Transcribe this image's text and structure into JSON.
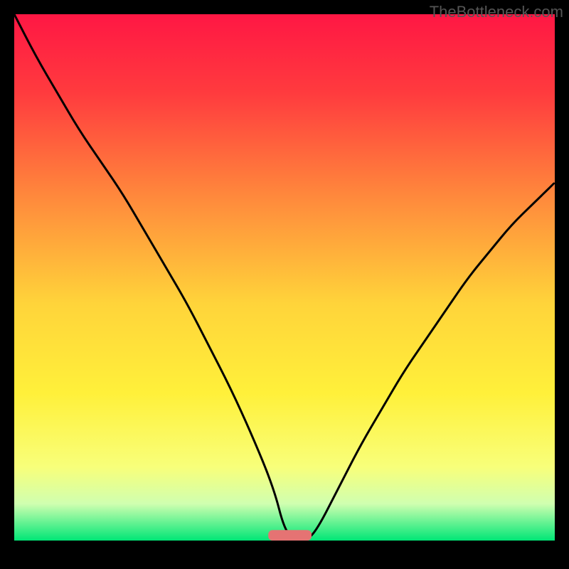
{
  "watermark": "TheBottleneck.com",
  "chart_data": {
    "type": "line",
    "title": "",
    "xlabel": "",
    "ylabel": "",
    "xlim": [
      0,
      100
    ],
    "ylim": [
      0,
      100
    ],
    "grid": false,
    "background_gradient": {
      "type": "vertical",
      "stops": [
        {
          "pos": 0.0,
          "color": "#ff1744"
        },
        {
          "pos": 0.15,
          "color": "#ff3b3e"
        },
        {
          "pos": 0.35,
          "color": "#ff8a3c"
        },
        {
          "pos": 0.55,
          "color": "#ffd43a"
        },
        {
          "pos": 0.72,
          "color": "#fff03a"
        },
        {
          "pos": 0.86,
          "color": "#f8ff7a"
        },
        {
          "pos": 0.93,
          "color": "#d0ffb0"
        },
        {
          "pos": 1.0,
          "color": "#00e676"
        }
      ]
    },
    "series": [
      {
        "name": "curve",
        "color": "#000000",
        "x": [
          0,
          4,
          8,
          12,
          16,
          20,
          24,
          28,
          32,
          36,
          40,
          44,
          48,
          50,
          52,
          54,
          56,
          60,
          64,
          68,
          72,
          76,
          80,
          84,
          88,
          92,
          96,
          100
        ],
        "y": [
          100,
          92,
          85,
          78,
          72,
          66,
          59,
          52,
          45,
          37,
          29,
          20,
          10,
          2,
          0,
          0,
          2,
          10,
          18,
          25,
          32,
          38,
          44,
          50,
          55,
          60,
          64,
          68
        ]
      }
    ],
    "marker": {
      "name": "bottleneck-marker",
      "color": "#e57373",
      "x": 51,
      "width": 8,
      "y": 0,
      "height": 2
    }
  }
}
